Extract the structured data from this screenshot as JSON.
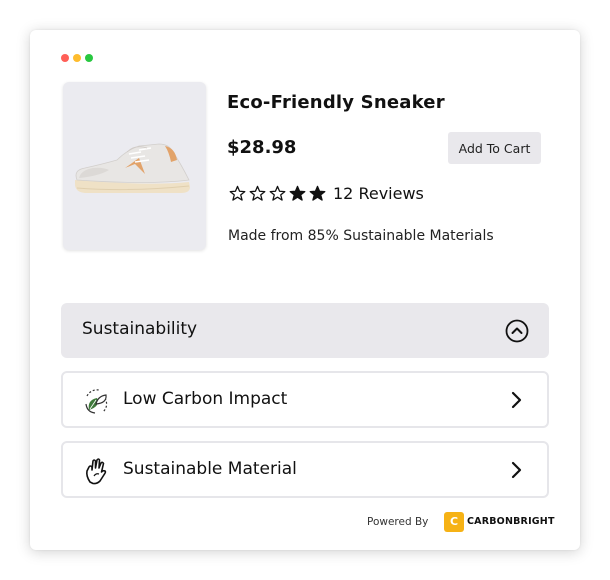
{
  "window": {
    "controls": [
      {
        "name": "close",
        "color": "#ff5f57"
      },
      {
        "name": "minimize",
        "color": "#febc2e"
      },
      {
        "name": "maximize",
        "color": "#28c840"
      }
    ]
  },
  "product": {
    "title": "Eco-Friendly Sneaker",
    "price": "$28.98",
    "add_to_cart_label": "Add To Cart",
    "rating": {
      "stars": [
        "empty",
        "empty",
        "empty",
        "filled",
        "filled"
      ],
      "reviews_text": "12 Reviews"
    },
    "material_text": "Made from 85% Sustainable Materials",
    "image_icon": "sneaker-image"
  },
  "sustainability": {
    "header_label": "Sustainability",
    "header_icon": "chevron-up-circle-icon",
    "items": [
      {
        "label": "Low Carbon Impact",
        "icon": "leaf-cycle-icon"
      },
      {
        "label": "Sustainable Material",
        "icon": "hand-icon"
      }
    ]
  },
  "footer": {
    "powered_by": "Powered By",
    "brand_letter": "C",
    "brand_name": "CARBONBRIGHT",
    "brand_color": "#f6b215"
  },
  "colors": {
    "panel_bg": "#e9e8ec",
    "image_bg": "#ebebf0"
  }
}
